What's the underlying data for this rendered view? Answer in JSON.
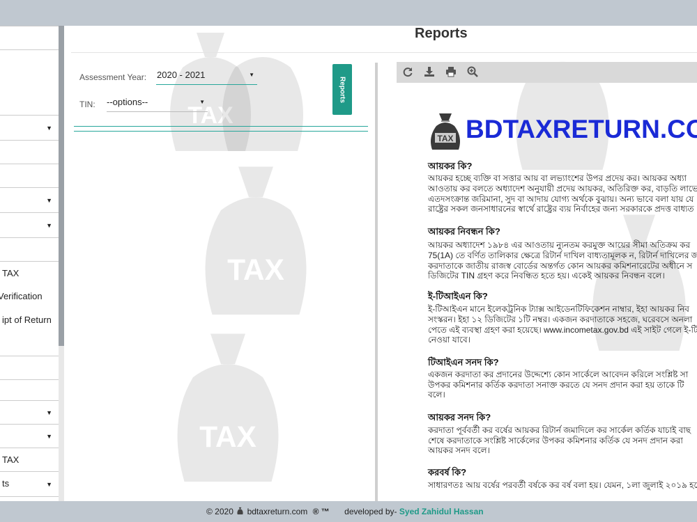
{
  "sidebar": {
    "items": [
      {
        "label": "",
        "caret": false
      },
      {
        "label": "",
        "caret": false
      },
      {
        "label": "",
        "caret": true
      },
      {
        "label": "",
        "caret": false
      },
      {
        "label": "",
        "caret": true
      },
      {
        "label": "",
        "caret": true
      },
      {
        "label": "",
        "caret": false
      },
      {
        "label": "TAX",
        "caret": false
      },
      {
        "label": "Verification",
        "caret": false
      },
      {
        "label": "ipt of Return",
        "caret": false
      },
      {
        "label": "",
        "caret": false
      },
      {
        "label": "",
        "caret": false
      },
      {
        "label": "",
        "caret": true
      },
      {
        "label": "",
        "caret": true
      },
      {
        "label": "TAX",
        "caret": false
      },
      {
        "label": "ts",
        "caret": true
      }
    ]
  },
  "page": {
    "title": "Reports"
  },
  "form": {
    "assessment_year_label": "Assessment Year:",
    "assessment_year_value": "2020 - 2021",
    "tin_label": "TIN:",
    "tin_value": "--options--",
    "reports_button": "Reports"
  },
  "toolbar": {
    "icons": [
      "refresh-icon",
      "download-icon",
      "print-icon",
      "zoom-in-icon"
    ]
  },
  "document": {
    "logo_text": "BDTAXRETURN.CO",
    "sections": [
      {
        "q": "আয়কর কি?",
        "lines": [
          "আয়কর হচ্ছে ব্যক্তি বা সত্তার আয় বা লভ্যাংশের উপর প্রদেয় কর। আয়কর অধ্যা",
          "আওতায় কর বলতে অধ্যাদেশ অনুযায়ী প্রদেয় আয়কর, অতিরিক্ত কর, বাড়তি লাভে",
          "এতদসংক্রান্ত জরিমানা, সুদ বা আদায় যোগ্য অর্থকে বুঝায়। অন্য ভাবে বলা যায় যে",
          "রাষ্ট্রের সকল জনসাধারনের স্বার্থে রাষ্ট্রের ব্যয় নির্বাহের জন্য সরকারকে প্রদত্ত বাধ্যত"
        ]
      },
      {
        "q": "আয়কর নিবন্ধন কি?",
        "lines": [
          "আয়কর অধ্যাদেশ ১৯৮৪ এর আওতায় ন্যুনতম করমুক্ত আয়ের সীমা অতিক্রম কর",
          "75(1A) তে বর্ণিত তালিকার ক্ষেত্রে রিটার্ন দাখিল বাধ্যতামূলক ন, রিটার্ন দাখিলের জ",
          "করদাতাকে জাতীয় রাজস্ব বোর্ডের অন্তর্গত কোন আয়কর কমিশনারেটের অধীনে স",
          "ডিজিটের TIN গ্রহণ করে নিবন্ধিত হতে হয়। একেই আয়কর নিবন্ধন বলে।"
        ]
      },
      {
        "q": "ই-টিআইএন কি?",
        "lines": [
          "ই-টিআইএন মানে ইলেকট্রনিক ট্যাক্স আইডেনটিফিকেশন নাম্বার, ইহা আয়কর নিব",
          "সংস্করন। ইহা ১২ ডিজিটের ১টি নম্বর। একজন করদাতাকে সহজে, ঘরেবসে অনলা",
          "পেতে এই ব্যবস্থা গ্রহণ করা হয়েছে। www.incometax.gov.bd এই সাইট গেলে ই-টি",
          "নেওয়া যাবে।"
        ]
      },
      {
        "q": "টিআইএন সনদ কি?",
        "lines": [
          "একজন করদাতা কর প্রদানের উদ্দেশ্যে কোন সার্কেলে আবেদন করিলে সংশ্লিষ্ট সা",
          "উপকর কমিশনার কর্তিক করদাতা সনাক্ত করতে যে সনদ প্রদান করা হয় তাকে টি",
          "বলে।"
        ]
      },
      {
        "q": "আয়কর সনদ কি?",
        "lines": [
          "করদাতা পূর্ববর্তী কর বর্ষের আয়কর রিটার্ন জমাদিলে কর সার্কেল কর্তিক যাচাই বাছ",
          "শেষে করদাতাকে সংশ্লিষ্ট সার্কেলের উপকর কমিশনার কর্তিক যে সনদ প্রদান করা",
          "আয়কর সনদ বলে।"
        ]
      },
      {
        "q": "করবর্ষ কি?",
        "lines": [
          "সাধারণতঃ আয় বর্ষের পরবর্তী বর্ষকে কর বর্ষ বলা হয়। যেমন, ১লা জুলাই ২০১৯ হতে"
        ]
      }
    ]
  },
  "footer": {
    "copyright": "© 2020",
    "site": "bdtaxreturn.com",
    "marks": "® ™",
    "developed_by": "developed by-",
    "developer": "Syed Zahidul Hassan"
  },
  "colors": {
    "accent": "#1f9a88",
    "logo": "#1a2ad6",
    "chrome": "#c0c8d0"
  }
}
